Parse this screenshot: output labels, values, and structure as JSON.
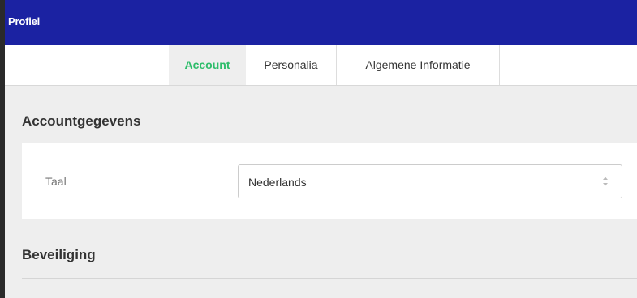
{
  "header": {
    "title": "Profiel"
  },
  "tabs": [
    {
      "label": "Account",
      "active": true
    },
    {
      "label": "Personalia",
      "active": false
    },
    {
      "label": "Algemene Informatie",
      "active": false
    }
  ],
  "account_section": {
    "title": "Accountgegevens",
    "language_label": "Taal",
    "language_value": "Nederlands",
    "language_icon": "sort-arrows-icon"
  },
  "security_section": {
    "title": "Beveiliging"
  },
  "colors": {
    "header_bg": "#1b22a2",
    "active_tab_text": "#2ebd6b",
    "page_bg": "#eeeeee"
  }
}
